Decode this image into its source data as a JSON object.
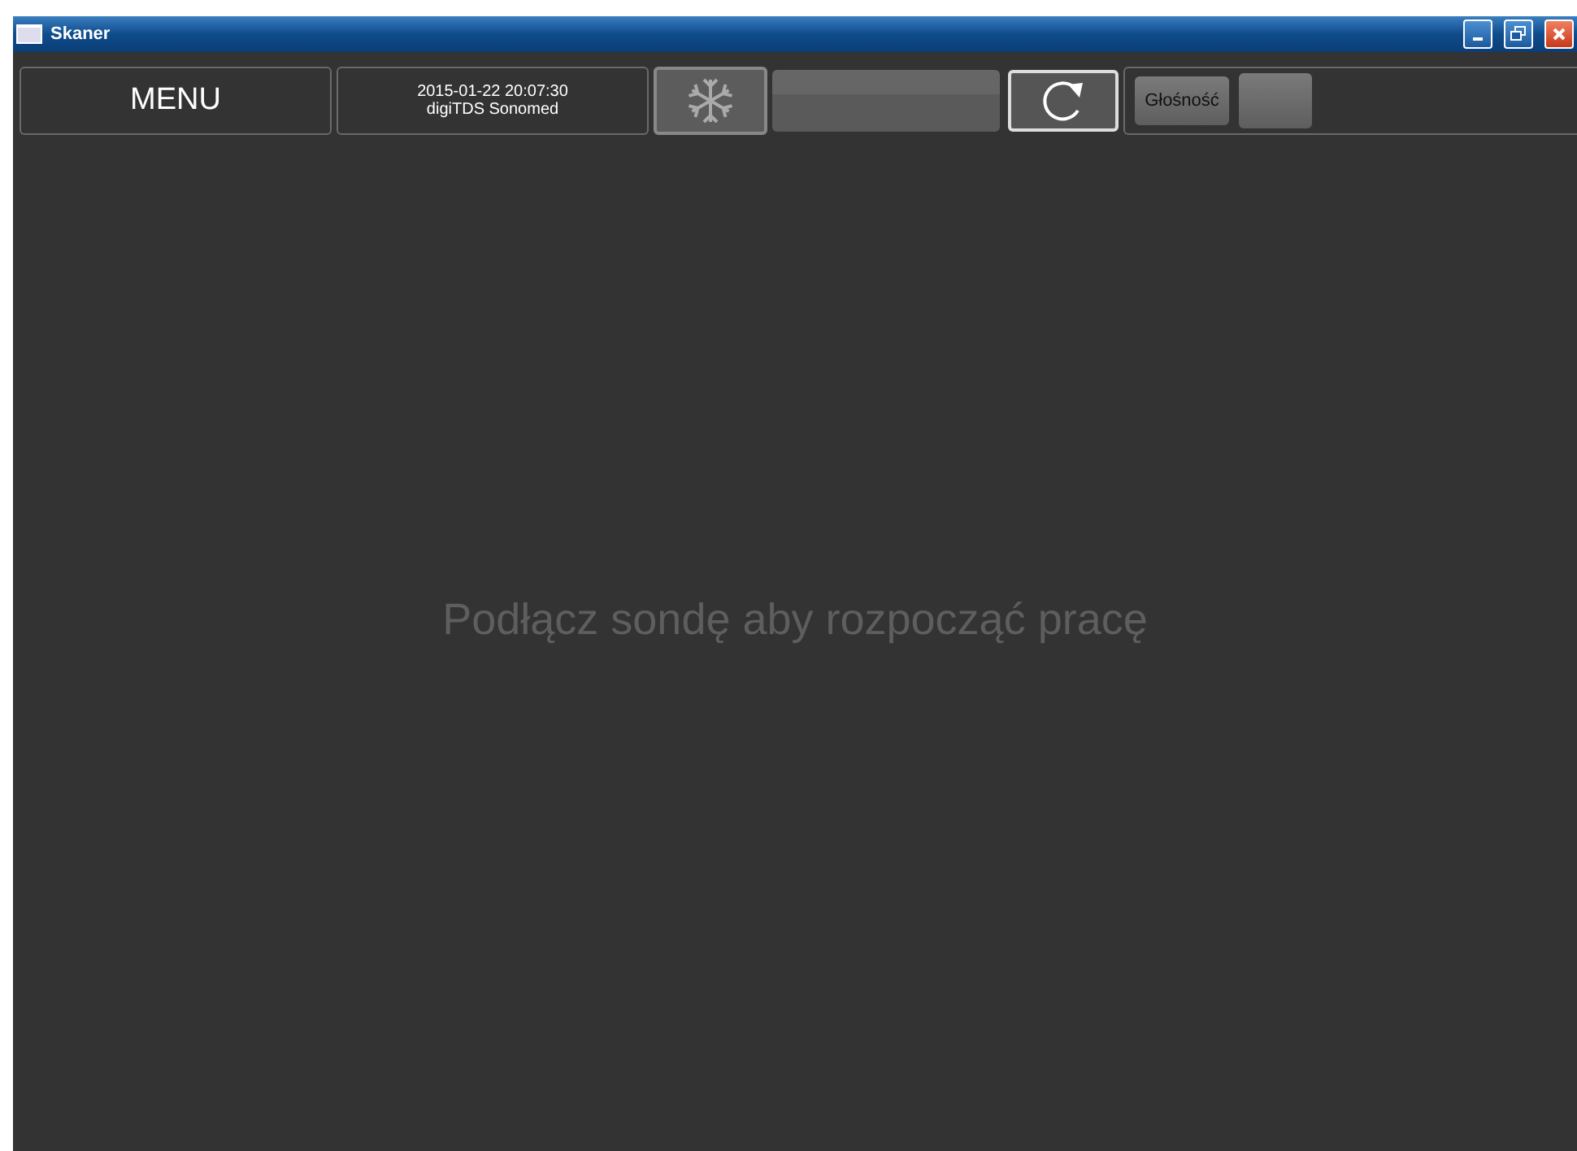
{
  "window": {
    "title": "Skaner"
  },
  "toolbar": {
    "menu": "MENU",
    "datetime": "2015-01-22 20:07:30",
    "device": "digiTDS Sonomed",
    "volume_button": "Głośność"
  },
  "message": "Podłącz sondę aby rozpocząć pracę"
}
